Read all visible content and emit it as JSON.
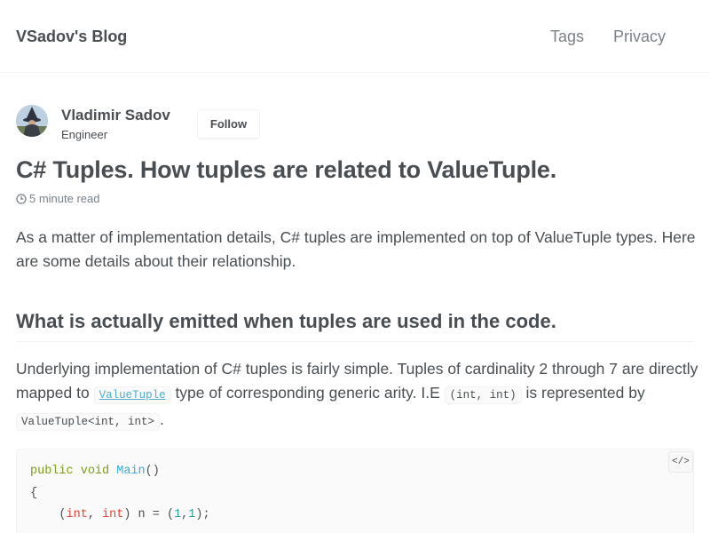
{
  "masthead": {
    "site_title": "VSadov's Blog",
    "nav": [
      {
        "label": "Tags"
      },
      {
        "label": "Privacy"
      }
    ]
  },
  "author": {
    "name": "Vladimir Sadov",
    "role": "Engineer",
    "follow_label": "Follow",
    "avatar_icon": "wizard-avatar"
  },
  "post": {
    "title": "C# Tuples. How tuples are related to ValueTuple.",
    "read_time": "5 minute read",
    "read_time_icon": "clock-icon",
    "intro": "As a matter of implementation details, C# tuples are implemented on top of ValueTuple types. Here are some details about their relationship.",
    "section_title": "What is actually emitted when tuples are used in the code.",
    "para": {
      "part1": "Underlying implementation of C# tuples is fairly simple. Tuples of cardinality 2 through 7 are directly mapped to ",
      "link_code": "ValueTuple",
      "part2": " type of corresponding generic arity. I.E ",
      "code1": "(int, int)",
      "part3": " is represented by ",
      "code2": "ValueTuple<int, int>",
      "part4": "."
    },
    "code_block": {
      "line1_kw1": "public",
      "line1_kw2": "void",
      "line1_fn": "Main",
      "line1_rest": "()",
      "line2": "{",
      "line3_open": "(",
      "line3_t1": "int",
      "line3_comma": ", ",
      "line3_t2": "int",
      "line3_mid": ") n = (",
      "line3_n1": "1",
      "line3_c": ",",
      "line3_n2": "1",
      "line3_end": ");",
      "copy_label": "</>",
      "copy_icon": "code-copy-icon"
    }
  },
  "colors": {
    "text": "#494e52",
    "muted": "#7a8288",
    "link": "#52adc8",
    "border": "#f2f3f3",
    "keyword": "#7c9c1c",
    "function": "#3fa8d3",
    "type": "#d94a3d"
  }
}
